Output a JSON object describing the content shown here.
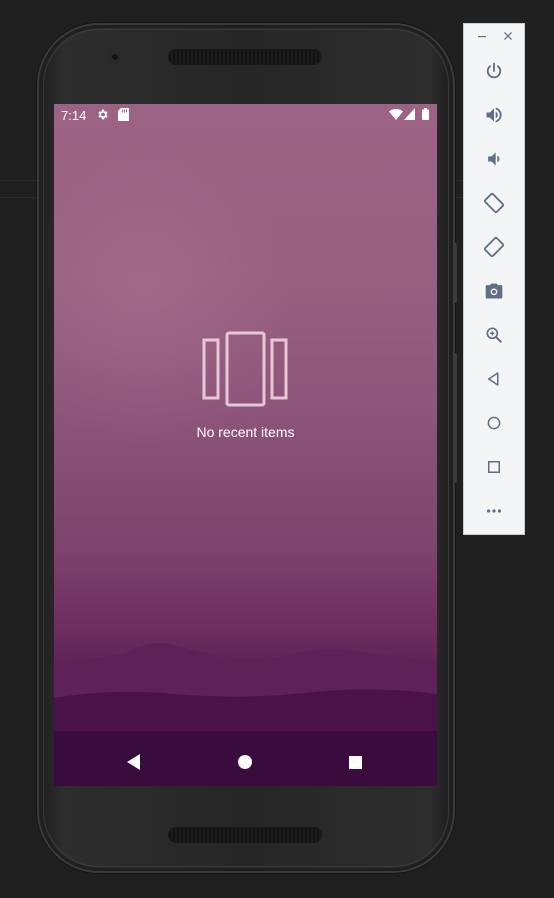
{
  "status_bar": {
    "time": "7:14",
    "icons": [
      "settings-icon",
      "sd-card-icon",
      "wifi-icon",
      "signal-icon",
      "battery-icon"
    ]
  },
  "recents": {
    "empty_icon": "recents-cards-icon",
    "empty_text": "No recent items"
  },
  "navigation": {
    "buttons": [
      "back-icon",
      "home-icon",
      "overview-icon"
    ],
    "color": "#ffffff"
  },
  "emulator_toolbar": {
    "window_controls": [
      "minimize-icon",
      "close-icon"
    ],
    "tools": [
      "power-icon",
      "volume-up-icon",
      "volume-down-icon",
      "rotate-left-icon",
      "rotate-right-icon",
      "screenshot-icon",
      "zoom-icon",
      "back-icon",
      "home-icon",
      "overview-icon",
      "more-icon"
    ],
    "icon_color": "#5f6f85"
  },
  "colors": {
    "wallpaper_top": "#9c6384",
    "wallpaper_bottom": "#3a0b3d",
    "phone_body": "#262626",
    "background": "#202020",
    "toolbar_bg": "#f4f5f6"
  }
}
